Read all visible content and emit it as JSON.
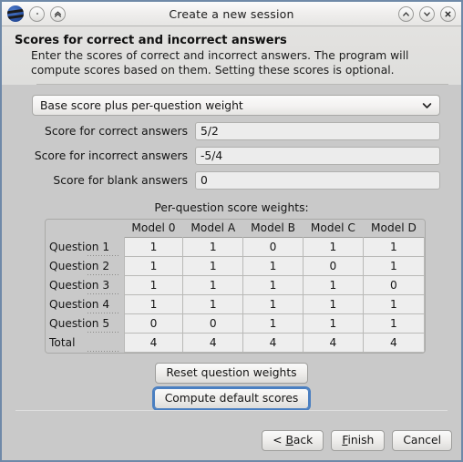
{
  "window": {
    "title": "Create a new session",
    "app_icon": "app-logo-icon",
    "titlebar_buttons": [
      {
        "name": "menu-dot-button",
        "icon": "dot-icon"
      },
      {
        "name": "shade-button",
        "icon": "double-chevron-up-icon"
      }
    ],
    "window_controls": [
      {
        "name": "maximize-button",
        "icon": "chevron-up-icon"
      },
      {
        "name": "minimize-button",
        "icon": "chevron-down-icon"
      },
      {
        "name": "close-button",
        "icon": "close-x-icon"
      }
    ]
  },
  "header": {
    "title": "Scores for correct and incorrect answers",
    "description": "Enter the scores of correct and incorrect answers. The program will compute scores based on them. Setting these scores is optional."
  },
  "form": {
    "mode_select": {
      "value": "Base score plus per-question weight",
      "icon": "chevron-down-icon"
    },
    "fields": [
      {
        "label": "Score for correct answers",
        "value": "5/2",
        "name": "score-correct-input"
      },
      {
        "label": "Score for incorrect answers",
        "value": "-5/4",
        "name": "score-incorrect-input"
      },
      {
        "label": "Score for blank answers",
        "value": "0",
        "name": "score-blank-input"
      }
    ]
  },
  "weights_table": {
    "caption": "Per-question score weights:",
    "columns": [
      "Model 0",
      "Model A",
      "Model B",
      "Model C",
      "Model D"
    ],
    "rows": [
      {
        "label": "Question 1",
        "values": [
          "1",
          "1",
          "0",
          "1",
          "1"
        ]
      },
      {
        "label": "Question 2",
        "values": [
          "1",
          "1",
          "1",
          "0",
          "1"
        ]
      },
      {
        "label": "Question 3",
        "values": [
          "1",
          "1",
          "1",
          "1",
          "0"
        ]
      },
      {
        "label": "Question 4",
        "values": [
          "1",
          "1",
          "1",
          "1",
          "1"
        ]
      },
      {
        "label": "Question 5",
        "values": [
          "0",
          "0",
          "1",
          "1",
          "1"
        ]
      },
      {
        "label": "Total",
        "values": [
          "4",
          "4",
          "4",
          "4",
          "4"
        ]
      }
    ]
  },
  "actions": {
    "reset_weights": "Reset question weights",
    "compute_defaults": "Compute default scores"
  },
  "footer": {
    "back": "< Back",
    "back_mnemonic": "B",
    "finish": "Finish",
    "finish_mnemonic": "F",
    "cancel": "Cancel"
  },
  "colors": {
    "window_border": "#6f89a8",
    "dialog_bg": "#c9c9c9",
    "header_bg": "#e0dfdd",
    "cell_bg": "#eeeeee",
    "focus_ring": "#4a7fc1"
  }
}
